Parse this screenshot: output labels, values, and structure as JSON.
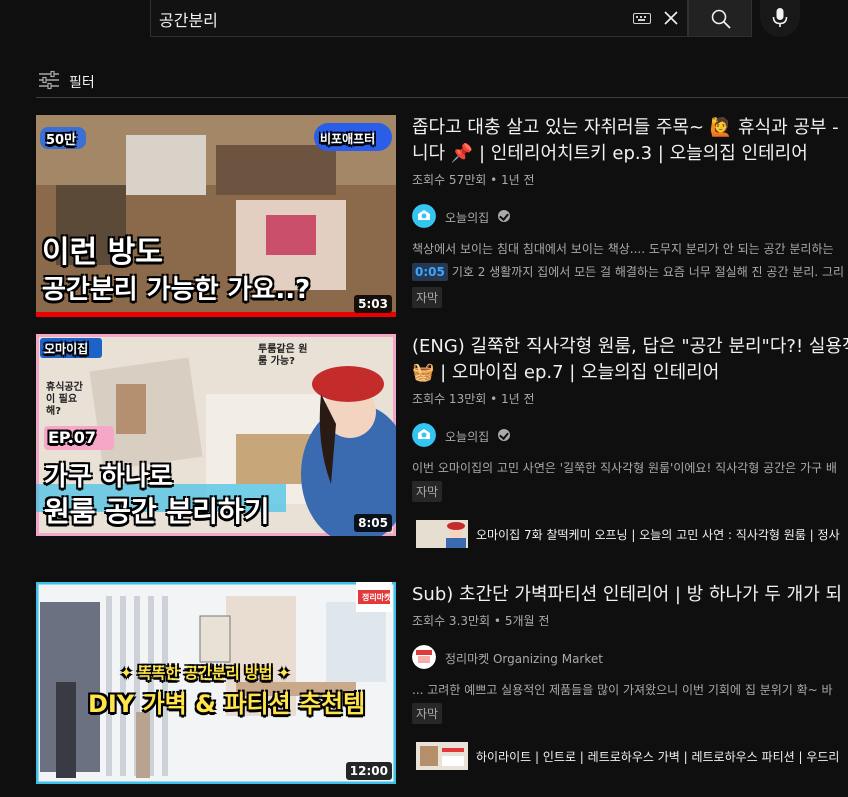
{
  "search": {
    "query": "공간분리"
  },
  "filter": {
    "label": "필터"
  },
  "results": [
    {
      "title_line1": "좁다고 대충 살고 있는 자취러들 주목~ 🙋 휴식과 공부 -",
      "title_line2": "니다 📌 | 인테리어치트키 ep.3 | 오늘의집 인테리어",
      "views": "조회수 57만회",
      "age": "1년 전",
      "channel": "오늘의집",
      "description": "책상에서 보이는 침대 침대에서 보이는 책상.... 도무지 분리가 안 되는 공간 분리하는",
      "timestamp": "0:05",
      "timestamp_text": "기호 2 생활까지 집에서 모든 걸 해결하는 요즘 너무 절실해 진 공간 분리. 그리",
      "cc": "자막",
      "duration": "5:03",
      "thumb": {
        "badge": "50만",
        "logo": "비포애프터",
        "line1": "이런 방도",
        "line2": "공간분리 가능한 가요..?"
      }
    },
    {
      "title_line1": "(ENG) 길쭉한 직사각형 원룸, 답은 \"공간 분리\"다?! 실용적",
      "title_line2": "🧺 | 오마이집 ep.7 | 오늘의집 인테리어",
      "views": "조회수 13만회",
      "age": "1년 전",
      "channel": "오늘의집",
      "description": "이번 오마이집의 고민 사연은 '길쭉한 직사각형 원룸'이에요! 직사각형 공간은 가구 배",
      "cc": "자막",
      "duration": "8:05",
      "chapter": "오마이집 7화 찰떡케미 오프닝 | 오늘의 고민 사연 : 직사각형 원룸 | 정사",
      "thumb": {
        "logo": "오마이집",
        "bubble1": "휴식공간이 필요해?",
        "bubble2": "투룸같은 원룸 가능?",
        "ep": "EP.07",
        "line1": "가구 하나로",
        "line2": "원룸 공간 분리하기"
      }
    },
    {
      "title_line1": "Sub) 초간단 가벽파티션 인테리어 | 방 하나가 두 개가 되",
      "views": "조회수 3.3만회",
      "age": "5개월 전",
      "channel": "정리마켓 Organizing Market",
      "description": "... 고려한 예쁘고 실용적인 제품들을 많이 가져왔으니 이번 기회에 집 분위기 확~ 바",
      "cc": "자막",
      "duration": "12:00",
      "chapter": "하이라이트 | 인트로 | 레트로하우스 가벽 | 레트로하우스 파티션 | 우드리",
      "thumb": {
        "logo": "정리마켓",
        "line1": "✦ 똑똑한 공간분리 방법 ✦",
        "line2": "DIY 가벽 & 파티션 추천템"
      }
    }
  ],
  "colors": {
    "background": "#0f0f0f",
    "link": "#3ea6ff",
    "meta": "#aaaaaa"
  }
}
